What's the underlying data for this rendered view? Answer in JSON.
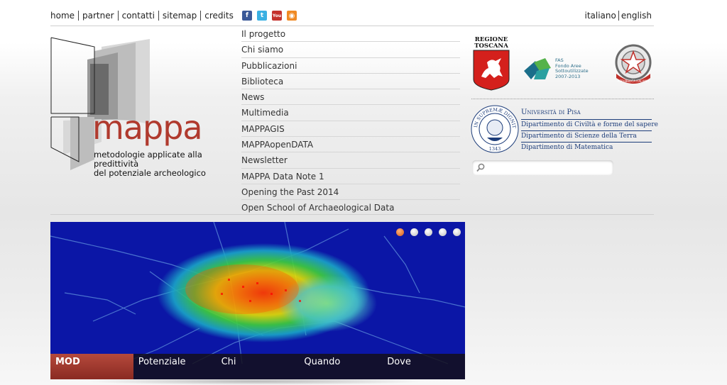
{
  "header": {
    "links": [
      {
        "label": "home"
      },
      {
        "label": "partner"
      },
      {
        "label": "contatti"
      },
      {
        "label": "sitemap"
      },
      {
        "label": "credits"
      }
    ],
    "social": [
      {
        "icon": "facebook-icon",
        "glyph": "f",
        "color": "#3b5998"
      },
      {
        "icon": "twitter-icon",
        "glyph": "t",
        "color": "#3ab0e2"
      },
      {
        "icon": "youtube-icon",
        "glyph": "You",
        "color": "#c4302b"
      },
      {
        "icon": "rss-icon",
        "glyph": "◉",
        "color": "#f08a24"
      }
    ],
    "languages": [
      {
        "label": "italiano"
      },
      {
        "label": "english"
      }
    ]
  },
  "logo": {
    "word": "mappa",
    "subtitle_line1": "metodologie applicate alla predittività",
    "subtitle_line2": "del potenziale archeologico",
    "brand_color": "#b03a2e"
  },
  "menu": [
    {
      "label": "Il progetto"
    },
    {
      "label": "Chi siamo"
    },
    {
      "label": "Pubblicazioni"
    },
    {
      "label": "Biblioteca"
    },
    {
      "label": "News"
    },
    {
      "label": "Multimedia"
    },
    {
      "label": "MAPPAGIS"
    },
    {
      "label": "MAPPAopenDATA"
    },
    {
      "label": "Newsletter"
    },
    {
      "label": "MAPPA Data Note 1"
    },
    {
      "label": "Opening the Past 2014"
    },
    {
      "label": "Open School of Archaeological Data"
    }
  ],
  "partners": {
    "regione_line1": "REGIONE",
    "regione_line2": "TOSCANA",
    "fas_line1": "FAS",
    "fas_line2": "Fondo Aree",
    "fas_line3": "Sottoutilizzate",
    "fas_line4": "2007-2013",
    "repubblica_text": "REPUBBLICA ITALIANA",
    "unipi_seal_text": "IN SUPREMÆ DIGNITATIS",
    "unipi_seal_year": "1343",
    "unipi_name": "Università di Pisa",
    "departments": [
      {
        "label": "Dipartimento di Civiltà e forme del sapere"
      },
      {
        "label": "Dipartimento di Scienze della Terra"
      },
      {
        "label": "Dipartimento di Matematica"
      }
    ]
  },
  "search": {
    "placeholder": "",
    "value": ""
  },
  "slider": {
    "tabs": [
      {
        "label": "MOD",
        "active": true
      },
      {
        "label": "Potenziale"
      },
      {
        "label": "Chi"
      },
      {
        "label": "Quando"
      },
      {
        "label": "Dove"
      }
    ],
    "active_dot": 1,
    "dot_count": 5
  }
}
